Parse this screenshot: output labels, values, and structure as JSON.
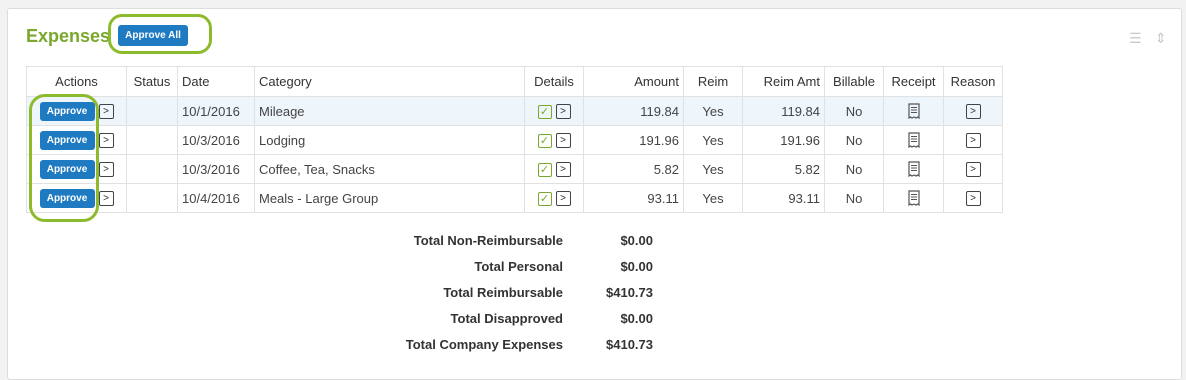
{
  "header": {
    "title": "Expenses",
    "approve_all_label": "Approve All"
  },
  "toolbar": {
    "icons": [
      "list-icon",
      "sort-icon"
    ]
  },
  "table": {
    "columns": [
      "Actions",
      "Status",
      "Date",
      "Category",
      "Details",
      "Amount",
      "Reim",
      "Reim Amt",
      "Billable",
      "Receipt",
      "Reason"
    ],
    "approve_label": "Approve",
    "rows": [
      {
        "status": "",
        "date": "10/1/2016",
        "category": "Mileage",
        "amount": "119.84",
        "reim": "Yes",
        "reim_amt": "119.84",
        "billable": "No"
      },
      {
        "status": "",
        "date": "10/3/2016",
        "category": "Lodging",
        "amount": "191.96",
        "reim": "Yes",
        "reim_amt": "191.96",
        "billable": "No"
      },
      {
        "status": "",
        "date": "10/3/2016",
        "category": "Coffee, Tea, Snacks",
        "amount": "5.82",
        "reim": "Yes",
        "reim_amt": "5.82",
        "billable": "No"
      },
      {
        "status": "",
        "date": "10/4/2016",
        "category": "Meals - Large Group",
        "amount": "93.11",
        "reim": "Yes",
        "reim_amt": "93.11",
        "billable": "No"
      }
    ]
  },
  "totals": [
    {
      "label": "Total Non-Reimbursable",
      "value": "$0.00"
    },
    {
      "label": "Total Personal",
      "value": "$0.00"
    },
    {
      "label": "Total Reimbursable",
      "value": "$410.73"
    },
    {
      "label": "Total Disapproved",
      "value": "$0.00"
    },
    {
      "label": "Total Company Expenses",
      "value": "$410.73"
    }
  ],
  "colors": {
    "accent_green": "#7aa72e",
    "button_blue": "#1f7bc1",
    "highlight_ring": "#8dbb2e"
  }
}
